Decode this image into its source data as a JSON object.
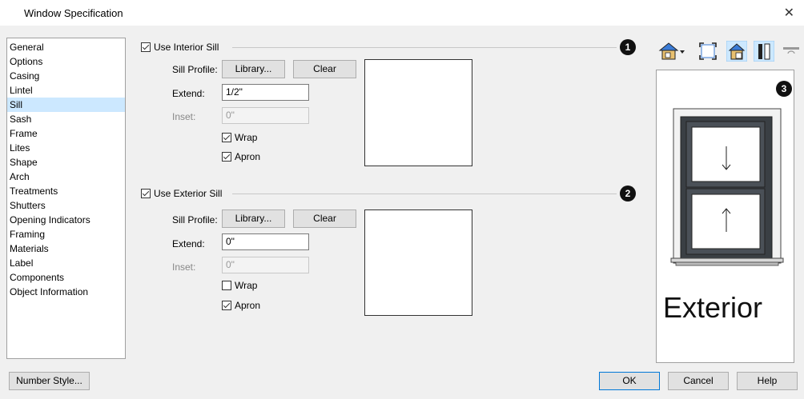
{
  "window": {
    "title": "Window Specification",
    "close_glyph": "✕"
  },
  "nav": {
    "items": [
      "General",
      "Options",
      "Casing",
      "Lintel",
      "Sill",
      "Sash",
      "Frame",
      "Lites",
      "Shape",
      "Arch",
      "Treatments",
      "Shutters",
      "Opening Indicators",
      "Framing",
      "Materials",
      "Label",
      "Components",
      "Object Information"
    ],
    "selected": "Sill"
  },
  "interior": {
    "checkbox_label": "Use Interior Sill",
    "checked": true,
    "badge": "1",
    "sill_profile_label": "Sill Profile:",
    "library_button": "Library...",
    "clear_button": "Clear",
    "extend_label": "Extend:",
    "extend_value": "1/2\"",
    "inset_label": "Inset:",
    "inset_value": "0\"",
    "wrap_label": "Wrap",
    "wrap_checked": true,
    "apron_label": "Apron",
    "apron_checked": true
  },
  "exterior": {
    "checkbox_label": "Use Exterior Sill",
    "checked": true,
    "badge": "2",
    "sill_profile_label": "Sill Profile:",
    "library_button": "Library...",
    "clear_button": "Clear",
    "extend_label": "Extend:",
    "extend_value": "0\"",
    "inset_label": "Inset:",
    "inset_value": "0\"",
    "wrap_label": "Wrap",
    "wrap_checked": false,
    "apron_label": "Apron",
    "apron_checked": true
  },
  "preview": {
    "badge": "3",
    "caption": "Exterior"
  },
  "toolbar": {
    "icons": [
      "view-mode-dropdown-icon",
      "fit-view-icon",
      "show-wall-icon",
      "frame-view-icon",
      "reset-view-icon"
    ]
  },
  "footer": {
    "number_style_button": "Number Style...",
    "ok_button": "OK",
    "cancel_button": "Cancel",
    "help_button": "Help"
  }
}
